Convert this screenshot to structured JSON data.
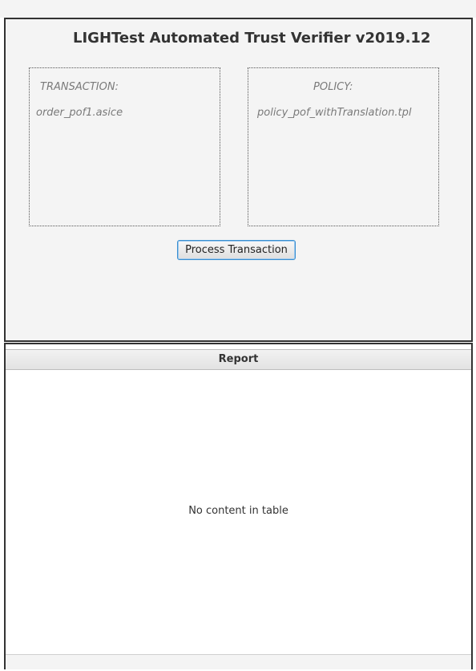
{
  "app": {
    "title": "LIGHTest Automated Trust Verifier v2019.12"
  },
  "transaction": {
    "label": "TRANSACTION:",
    "file": "order_pof1.asice"
  },
  "policy": {
    "label": "POLICY:",
    "file": "policy_pof_withTranslation.tpl"
  },
  "actions": {
    "process_label": "Process Transaction"
  },
  "report_table": {
    "columns": [
      "Report"
    ],
    "rows": [],
    "placeholder": "No content in table"
  },
  "colors": {
    "background": "#f4f4f4",
    "frame_border": "#333333",
    "button_focus": "#3a8fd0",
    "muted_text": "#7a7a7a"
  }
}
